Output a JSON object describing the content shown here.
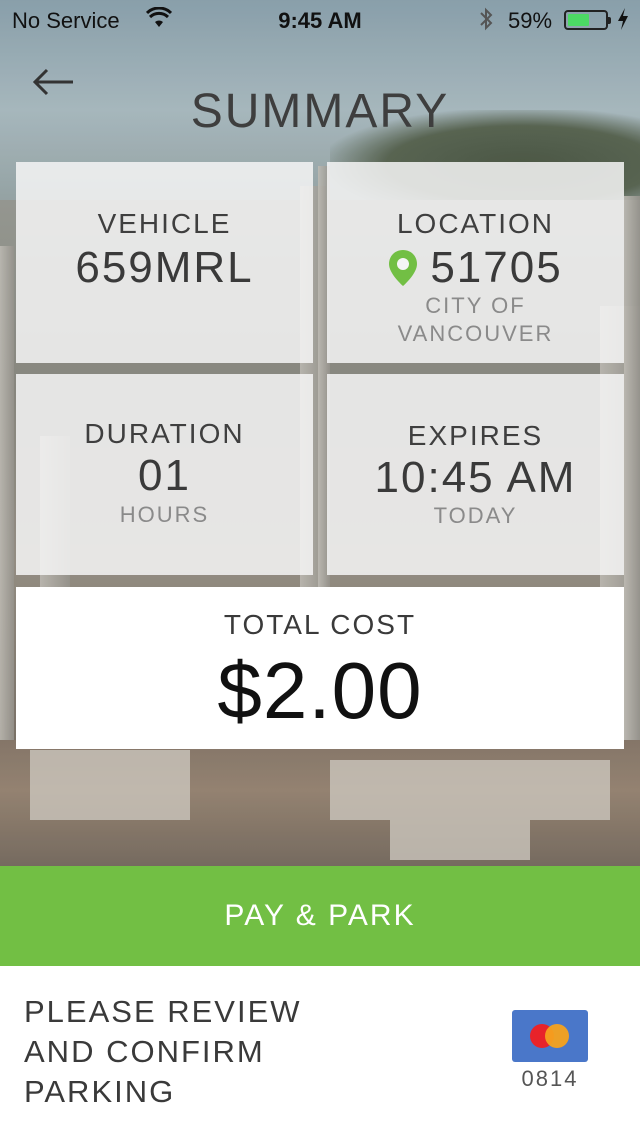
{
  "status_bar": {
    "carrier": "No Service",
    "time": "9:45 AM",
    "battery_percent": "59%",
    "battery_level": 0.59,
    "icons": [
      "wifi-icon",
      "bluetooth-icon",
      "battery-icon",
      "charging-bolt-icon"
    ]
  },
  "header": {
    "back_icon": "←",
    "title": "SUMMARY"
  },
  "vehicle": {
    "label": "VEHICLE",
    "value": "659MRL"
  },
  "location": {
    "label": "LOCATION",
    "value": "51705",
    "sub_line1": "CITY OF",
    "sub_line2": "VANCOUVER",
    "pin_color": "#72bf44"
  },
  "duration": {
    "label": "DURATION",
    "value": "01",
    "sub": "HOURS"
  },
  "expires": {
    "label": "EXPIRES",
    "value": "10:45 AM",
    "sub": "TODAY"
  },
  "total": {
    "label": "TOTAL COST",
    "amount": "$2.00"
  },
  "pay_button": {
    "label": "PAY & PARK",
    "color": "#72bf44"
  },
  "footer": {
    "message_line1": "PLEASE REVIEW",
    "message_line2": "AND CONFIRM",
    "message_line3": "PARKING",
    "card_last4": "0814",
    "card_brand_icon": "mastercard-icon"
  }
}
